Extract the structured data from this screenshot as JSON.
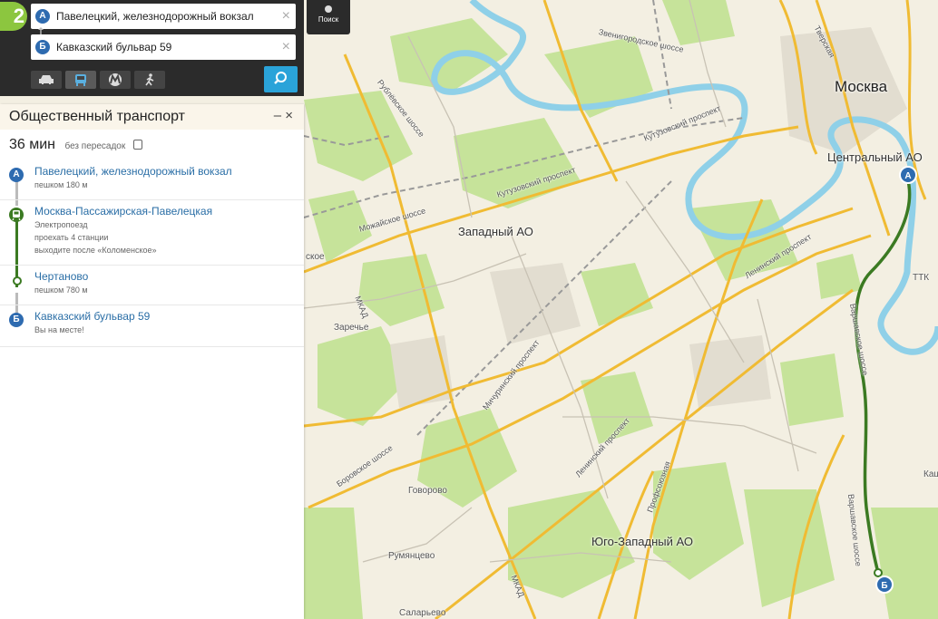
{
  "app": {
    "logo_text": "2"
  },
  "route_form": {
    "from_marker": "А",
    "from_value": "Павелецкий, железнодорожный вокзал",
    "to_marker": "Б",
    "to_value": "Кавказский бульвар 59",
    "clear_icon": "×",
    "swap_icon": "swap-icon",
    "transport_modes": [
      {
        "name": "car",
        "icon": "car-icon",
        "active": false
      },
      {
        "name": "public-transport",
        "icon": "bus-icon",
        "active": true
      },
      {
        "name": "metro",
        "icon": "metro-icon",
        "active": false
      },
      {
        "name": "pedestrian",
        "icon": "walk-icon",
        "active": false
      }
    ],
    "search_icon": "search-icon"
  },
  "search_button": {
    "label": "Поиск",
    "icon": "pin-icon"
  },
  "panel": {
    "title": "Общественный транспорт",
    "controls": "– ×",
    "duration": "36 мин",
    "transfers": "без пересадок",
    "steps": [
      {
        "marker": "А",
        "title": "Павелецкий, железнодорожный вокзал",
        "lines": [
          "пешком 180 м"
        ]
      },
      {
        "marker": "train-icon",
        "title": "Москва-Пассажирская-Павелецкая",
        "lines": [
          "Электропоезд",
          "проехать 4 станции",
          "выходите после «Коломенское»"
        ]
      },
      {
        "marker": "stop-icon",
        "title": "Чертаново",
        "lines": [
          "пешком 780 м"
        ]
      },
      {
        "marker": "Б",
        "title": "Кавказский бульвар 59",
        "lines": [
          "Вы на месте!"
        ]
      }
    ]
  },
  "map": {
    "labels": {
      "moscow": "Москва",
      "central_ao": "Центральный АО",
      "western_ao": "Западный АО",
      "southwest_ao": "Юго-Западный АО",
      "zarechye": "Заречье",
      "govorovo": "Говорово",
      "rumyantsevo": "Румянцево",
      "salaryevo": "Саларьево",
      "ttk": "ТТК",
      "kash": "Каш",
      "ekoe": "ское"
    },
    "roads": {
      "zvenigorod": "Звенигородское шоссе",
      "tverskaya": "Тверская",
      "rublevskoe": "Рублёвское шоссе",
      "kutuzovsky": "Кутузовский проспект",
      "kutuzovsky2": "Кутузовский проспект",
      "mozhayskoe": "Можайское шоссе",
      "leninsky": "Ленинский проспект",
      "leninsky2": "Ленинский проспект",
      "mkad": "МКАД",
      "mkad2": "МКАД",
      "michurinsky": "Мичуринский проспект",
      "borovskoe": "Боровское шоссе",
      "profsoyuznaya": "Профсоюзная",
      "varshavskoe": "Варшавское шоссе",
      "varshavskoe2": "Варшавское шоссе"
    },
    "route_marker_a": "А",
    "route_marker_b": "Б",
    "colors": {
      "route": "#3b7a22",
      "river": "#8fd0e8",
      "park": "#bfe08f",
      "major_road": "#f4c542",
      "railway": "#999999"
    }
  }
}
